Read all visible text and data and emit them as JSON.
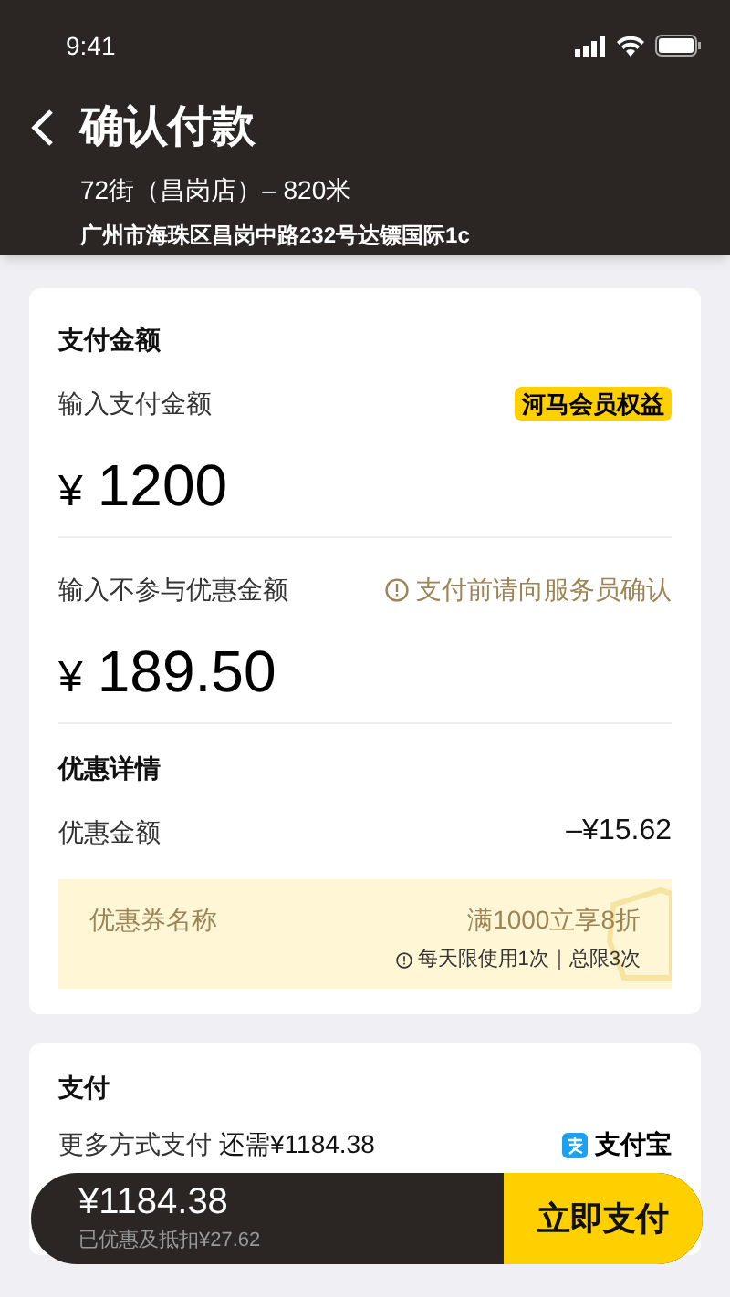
{
  "status_bar": {
    "time": "9:41"
  },
  "header": {
    "title": "确认付款",
    "store": "72街（昌岗店）– 820米",
    "address": "广州市海珠区昌岗中路232号达镖国际1c"
  },
  "amount_card": {
    "title": "支付金额",
    "pay_input": {
      "label": "输入支付金额",
      "badge": "河马会员权益",
      "currency": "¥",
      "value": "1200"
    },
    "excluded_input": {
      "label": "输入不参与优惠金额",
      "notice": "支付前请向服务员确认",
      "currency": "¥",
      "value": "189.50"
    },
    "discount": {
      "title": "优惠详情",
      "label": "优惠金额",
      "value": "–¥15.62",
      "coupon": {
        "name": "优惠券名称",
        "rule": "满1000立享8折",
        "limit": "每天限使用1次｜总限3次"
      }
    }
  },
  "payment_card": {
    "title": "支付",
    "method_label": "更多方式支付",
    "remaining": "还需¥1184.38",
    "provider": "支付宝"
  },
  "bottom_bar": {
    "total": "¥1184.38",
    "saved": "已优惠及抵扣¥27.62",
    "button": "立即支付"
  }
}
